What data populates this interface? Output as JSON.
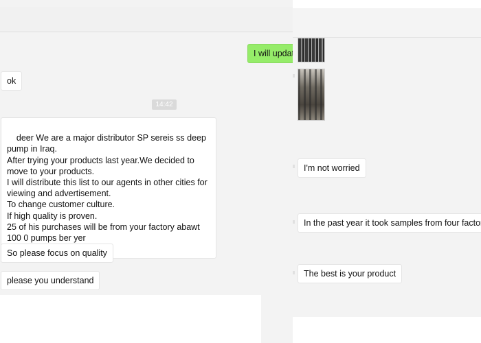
{
  "left_chat": {
    "sent": {
      "text": "I will updat"
    },
    "messages": [
      {
        "text": "ok"
      },
      {
        "text": "deer We are a major distributor SP sereis ss deep pump in Iraq.\nAfter trying your products last year.We decided to move to your products.\nI will distribute this list to our agents in other cities for viewing and advertisement.\nTo change customer culture.\nIf high quality is proven.\n25 of his purchases will be from your factory abawt 100 0 pumps ber yer"
      },
      {
        "text": "So please focus on quality"
      },
      {
        "text": "please  you understand"
      }
    ],
    "timestamp": "14:42"
  },
  "right_chat": {
    "images": [
      {
        "icon": "pipes-photo"
      },
      {
        "icon": "warehouse-photo"
      }
    ],
    "messages": [
      {
        "text": "I'm not worried"
      },
      {
        "text": "In the past year it took samples from four factories"
      },
      {
        "text": "The best is your product"
      }
    ]
  },
  "colors": {
    "sent_bubble": "#95ec69",
    "chat_background": "#f3f3f3",
    "timestamp_badge": "#dadada"
  }
}
